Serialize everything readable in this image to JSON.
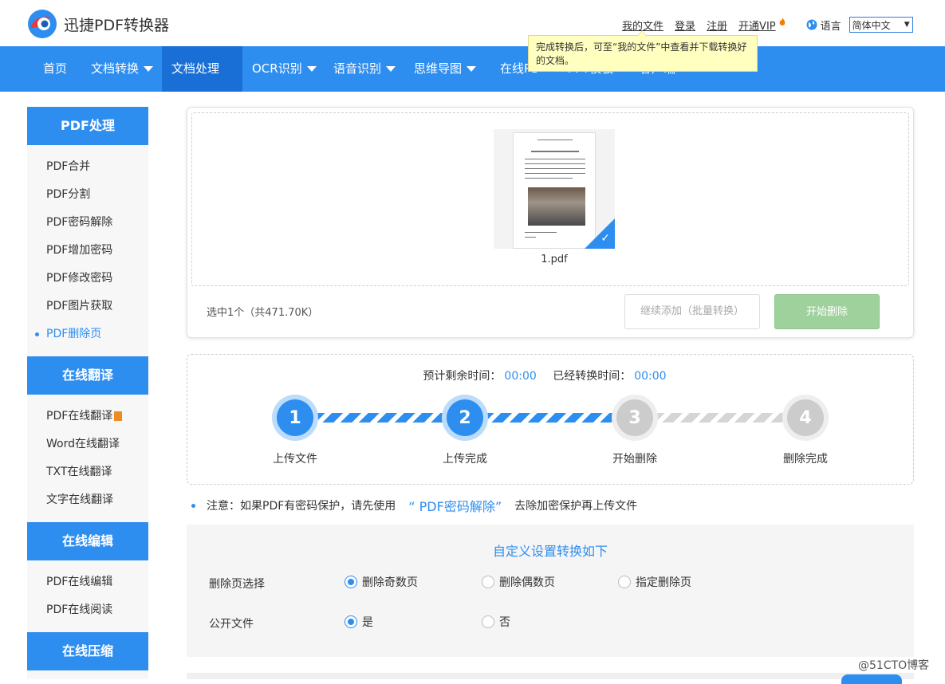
{
  "header": {
    "brand": "迅捷PDF转换器",
    "links": [
      "我的文件",
      "登录",
      "注册",
      "开通VIP"
    ],
    "lang_label": "语言",
    "lang_value": "简体中文",
    "tooltip": "完成转换后，可至“我的文件”中查看并下载转换好的文档。"
  },
  "nav": {
    "items": [
      {
        "label": "首页"
      },
      {
        "label": "文档转换"
      },
      {
        "label": "文档处理"
      },
      {
        "label": "OCR识别"
      },
      {
        "label": "语音识别"
      },
      {
        "label": "思维导图"
      },
      {
        "label": "在线PS"
      },
      {
        "label": "PPT模板"
      },
      {
        "label": "客户端"
      }
    ]
  },
  "sidebar": {
    "sections": [
      {
        "title": "PDF处理",
        "items": [
          "PDF合并",
          "PDF分割",
          "PDF密码解除",
          "PDF增加密码",
          "PDF修改密码",
          "PDF图片获取",
          "PDF删除页"
        ]
      },
      {
        "title": "在线翻译",
        "items": [
          "PDF在线翻译",
          "Word在线翻译",
          "TXT在线翻译",
          "文字在线翻译"
        ]
      },
      {
        "title": "在线编辑",
        "items": [
          "PDF在线编辑",
          "PDF在线阅读"
        ]
      },
      {
        "title": "在线压缩",
        "items": []
      }
    ]
  },
  "upload": {
    "file_name": "1.pdf",
    "selection_info": "选中1个（共471.70K）",
    "add_button": "继续添加（批量转换）",
    "start_button": "开始删除"
  },
  "progress": {
    "remaining_label": "预计剩余时间：",
    "remaining_value": "00:00",
    "elapsed_label": "已经转换时间：",
    "elapsed_value": "00:00",
    "steps": [
      {
        "num": "1",
        "label": "上传文件"
      },
      {
        "num": "2",
        "label": "上传完成"
      },
      {
        "num": "3",
        "label": "开始删除"
      },
      {
        "num": "4",
        "label": "删除完成"
      }
    ]
  },
  "note": {
    "prefix": "注意：如果PDF有密码保护，请先使用",
    "link": "“ PDF密码解除”",
    "suffix": "去除加密保护再上传文件"
  },
  "settings": {
    "title": "自定义设置转换如下",
    "rows": [
      {
        "label": "删除页选择",
        "options": [
          "删除奇数页",
          "删除偶数页",
          "指定删除页"
        ],
        "selected": 0
      },
      {
        "label": "公开文件",
        "options": [
          "是",
          "否"
        ],
        "selected": 0
      }
    ]
  },
  "watermark": "@51CTO博客",
  "colors": {
    "primary": "#2e8ef0",
    "start_button": "#9ed19b",
    "tooltip_bg": "#ffffc0"
  }
}
